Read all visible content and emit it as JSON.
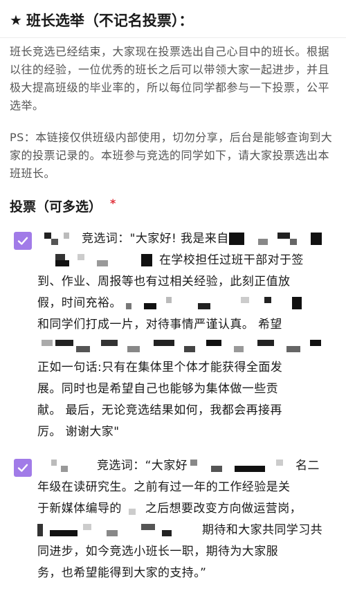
{
  "header": {
    "title": "班长选举（不记名投票）："
  },
  "intro": {
    "text": "班长竞选已经结束，大家现在投票选出自己心目中的班长。根据以往的经验，一位优秀的班长之后可以带领大家一起进步，并且极大提高班级的毕业率的，所以每位同学都参与一下投票，公平选举。",
    "ps": "PS：本链接仅供班级内部使用，切勿分享，后台是能够查询到大家的投票记录的。本班参与竞选的同学如下，请大家投票选出本班班长。"
  },
  "question": {
    "label": "投票（可多选）",
    "required_mark": "*"
  },
  "options": [
    {
      "checked": true,
      "line1": "竞选词：\"大家好! 我是来自",
      "line2": "在学校担任过班干部对于签",
      "line3": "到、作业、周报等也有过相关经验，此刻正值放",
      "line4": "假，时间充裕。",
      "line5": "和同学们打成一片，对待事情严谨认真。 希望",
      "line6": "正如一句话:只有在集体里个体才能获得全面发",
      "line7": "展。同时也是希望自己也能够为集体做一些贡",
      "line8": "献。 最后，无论竞选结果如何，我都会再接再",
      "line9": "厉。 谢谢大家\""
    },
    {
      "checked": true,
      "line1": "竞选词：“大家好",
      "line1b": "名二",
      "line2": "年级在读研究生。之前有过一年的工作经验是关",
      "line3": "于新媒体编导的",
      "line3b": "之后想要改变方向做运营岗，",
      "line4": "期待和大家共同学习共",
      "line5": "同进步，如今竞选小班长一职，期待为大家服",
      "line6": "务，也希望能得到大家的支持。”"
    }
  ],
  "colors": {
    "accent": "#a17be8",
    "required": "#e0303a",
    "body_text": "#555555"
  }
}
